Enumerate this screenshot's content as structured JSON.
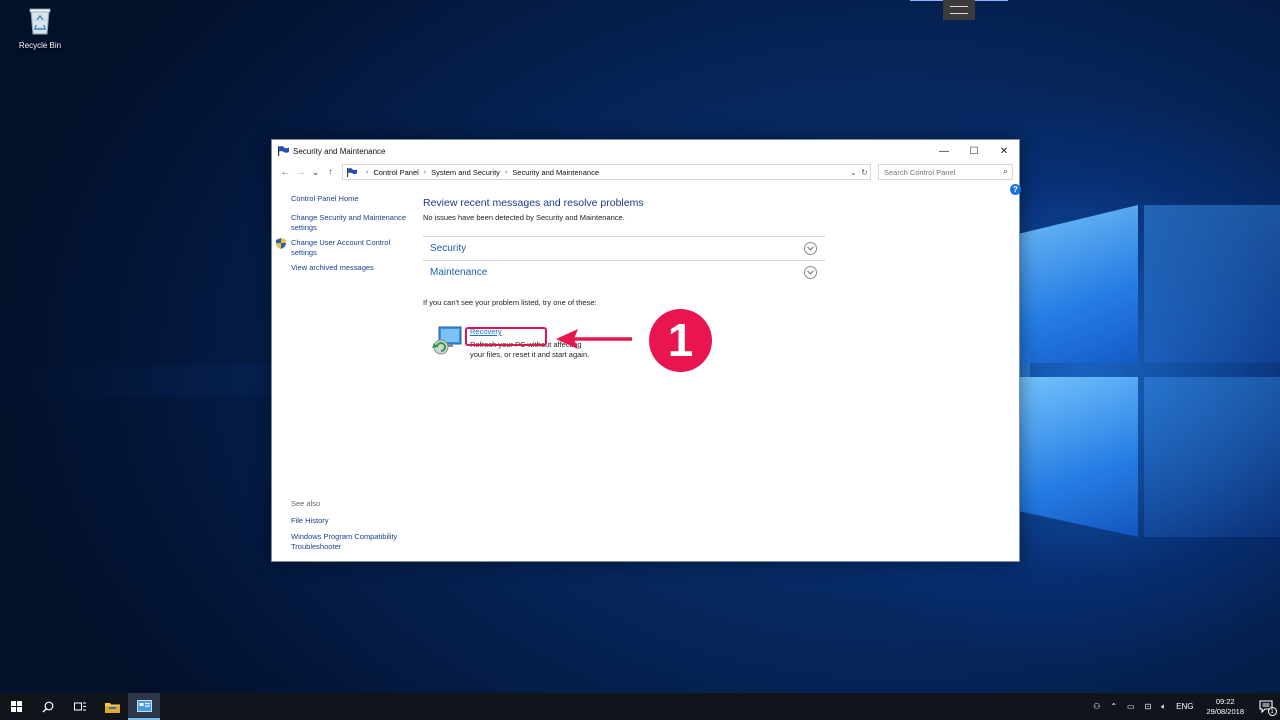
{
  "desktop": {
    "icons": [
      {
        "label": "Recycle Bin",
        "icon": "recycle-bin-icon"
      }
    ]
  },
  "window": {
    "title": "Security and Maintenance",
    "controls": {
      "minimize": "—",
      "maximize": "☐",
      "close": "✕"
    },
    "nav": {
      "back": "←",
      "forward": "→",
      "recent": "⌄",
      "up": "↑"
    },
    "breadcrumbs": [
      "Control Panel",
      "System and Security",
      "Security and Maintenance"
    ],
    "search_placeholder": "Search Control Panel",
    "help": "?"
  },
  "sidebar": {
    "home": "Control Panel Home",
    "links": [
      "Change Security and Maintenance settings",
      "Change User Account Control settings",
      "View archived messages"
    ],
    "see_also_header": "See also",
    "see_also": [
      "File History",
      "Windows Program Compatibility Troubleshooter"
    ]
  },
  "main": {
    "heading": "Review recent messages and resolve problems",
    "status": "No issues have been detected by Security and Maintenance.",
    "sections": [
      "Security",
      "Maintenance"
    ],
    "hint": "If you can't see your problem listed, try one of these:",
    "recovery": {
      "link": "Recovery",
      "desc_line1": "Refresh your PC without affecting",
      "desc_line2": "your files, or reset it and start again."
    }
  },
  "annotation": {
    "step": "1",
    "color": "#e8154f"
  },
  "taskbar": {
    "language": "ENG",
    "time": "09:22",
    "date": "29/08/2018",
    "notification_count": "1"
  }
}
